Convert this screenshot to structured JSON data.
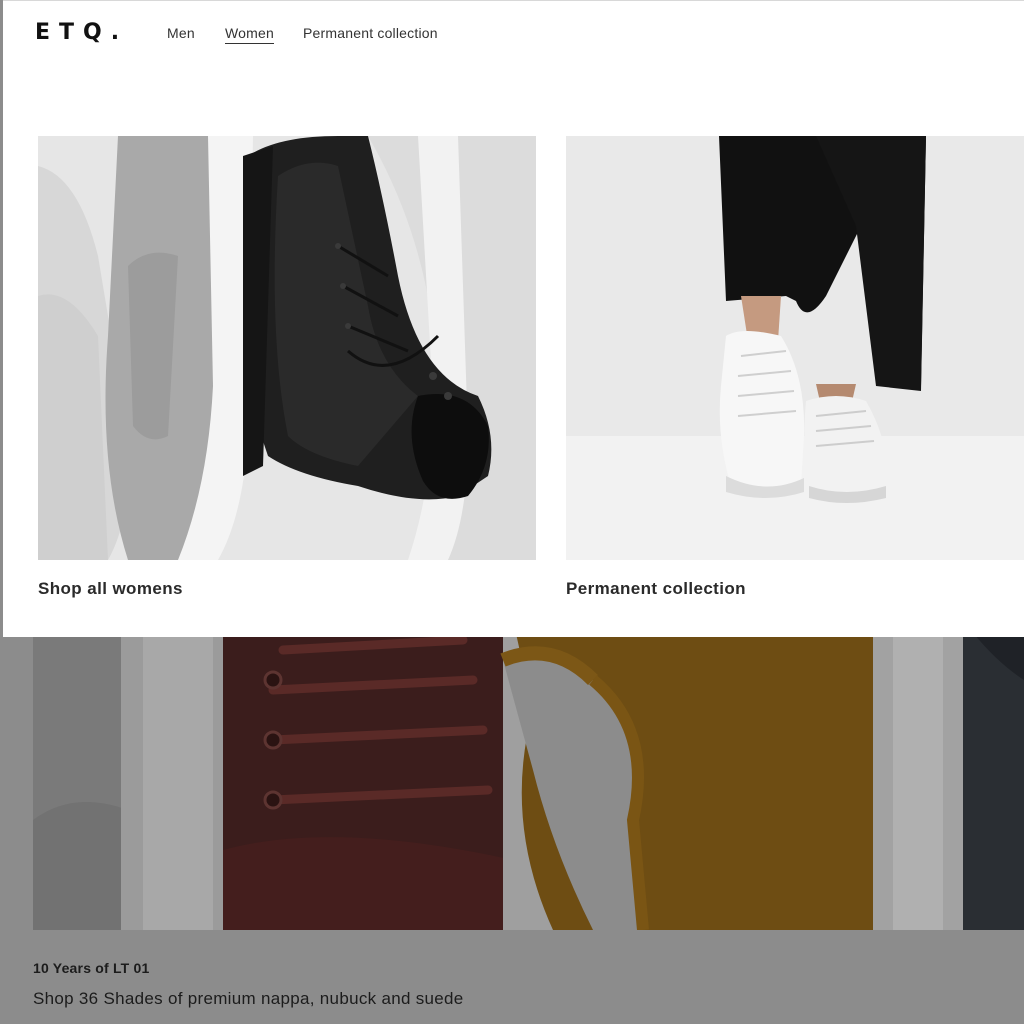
{
  "header": {
    "logo": "ETQ.",
    "nav": [
      {
        "label": "Men"
      },
      {
        "label": "Women",
        "active": true
      },
      {
        "label": "Permanent collection"
      }
    ]
  },
  "menu": {
    "cards": [
      {
        "label": "Shop all womens",
        "image": "photo of white sneakers and black leather boot"
      },
      {
        "label": "Permanent collection",
        "image": "photo of person wearing black trousers and white sneakers"
      }
    ]
  },
  "hero": {
    "eyebrow": "10 Years of LT 01",
    "subtitle": "Shop 36 Shades of premium nappa, nubuck and suede"
  },
  "colors": {
    "overlay_bg": "#8c8c8c",
    "panel_bg": "#ffffff",
    "text": "#222222"
  }
}
